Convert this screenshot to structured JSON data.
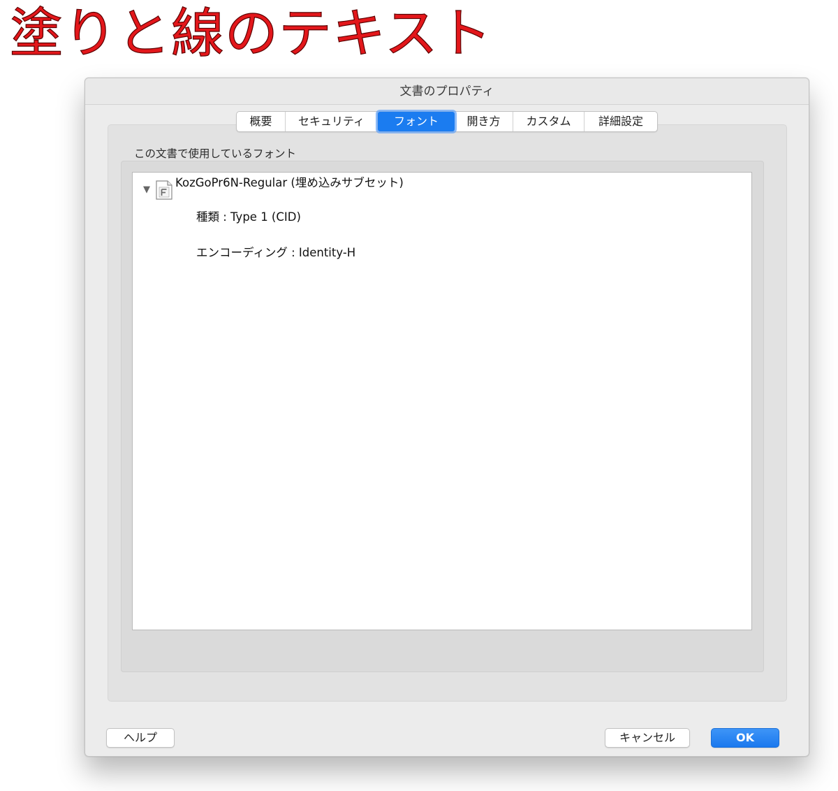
{
  "headline": "塗りと線のテキスト",
  "dialog": {
    "title": "文書のプロパティ",
    "tabs": [
      {
        "label": "概要"
      },
      {
        "label": "セキュリティ"
      },
      {
        "label": "フォント"
      },
      {
        "label": "開き方"
      },
      {
        "label": "カスタム"
      },
      {
        "label": "詳細設定"
      }
    ],
    "active_tab": "フォント",
    "section_label": "この文書で使用しているフォント",
    "fonts": [
      {
        "name": "KozGoPr6N-Regular (埋め込みサブセット)",
        "type": "種類 : Type 1 (CID)",
        "encoding": "エンコーディング : Identity-H",
        "expanded": true,
        "icon": "font-file-icon"
      }
    ],
    "buttons": {
      "help": "ヘルプ",
      "cancel": "キャンセル",
      "ok": "OK"
    }
  },
  "colors": {
    "headline_fill": "#e3171b",
    "accent": "#1b7cf0"
  }
}
